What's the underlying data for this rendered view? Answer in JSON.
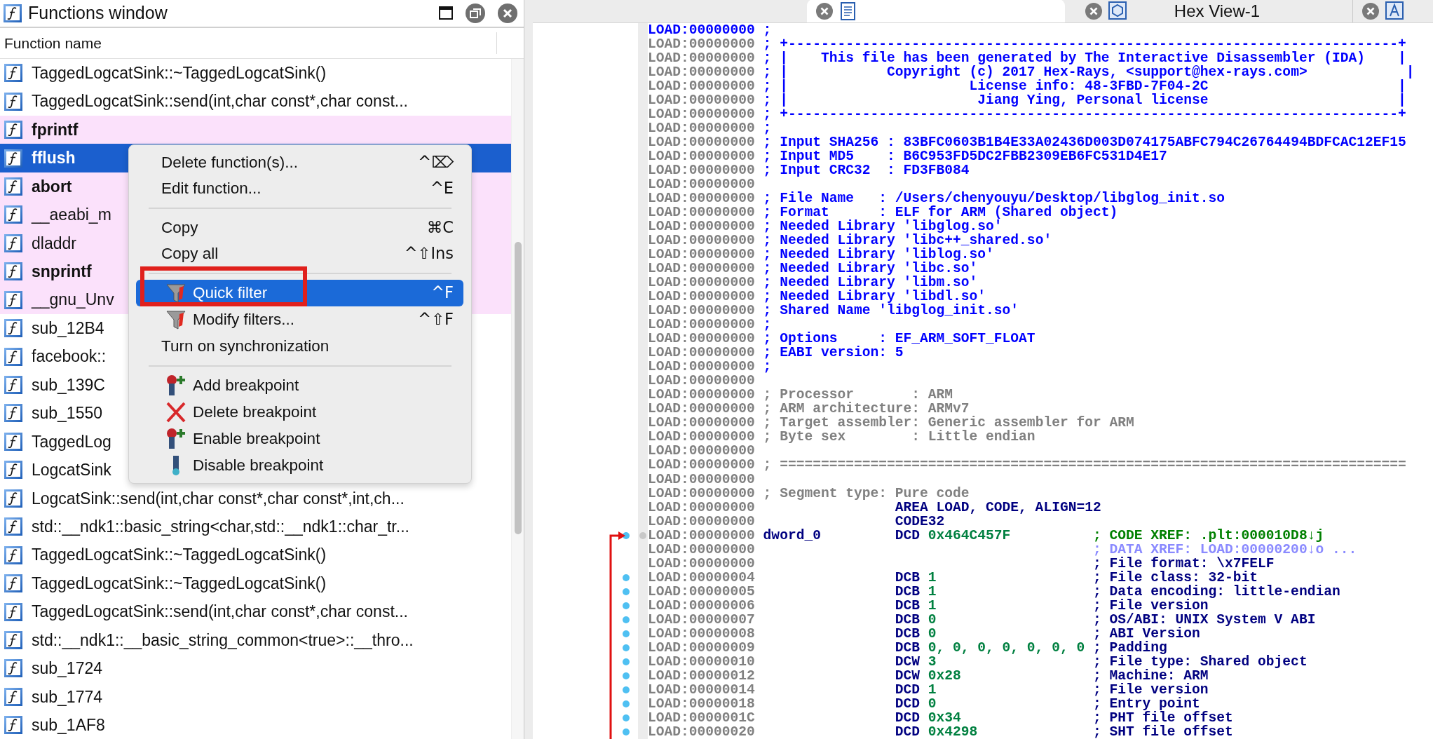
{
  "functions_window": {
    "title": "Functions window",
    "column": "Function name",
    "rows": [
      {
        "name": "TaggedLogcatSink::~TaggedLogcatSink()",
        "library": false,
        "bold": false,
        "selected": false
      },
      {
        "name": "TaggedLogcatSink::send(int,char const*,char const...",
        "library": false,
        "bold": false,
        "selected": false
      },
      {
        "name": "fprintf",
        "library": true,
        "bold": true,
        "selected": false
      },
      {
        "name": "fflush",
        "library": true,
        "bold": true,
        "selected": true
      },
      {
        "name": "abort",
        "library": true,
        "bold": true,
        "selected": false
      },
      {
        "name": "__aeabi_m",
        "library": true,
        "bold": false,
        "selected": false
      },
      {
        "name": "dladdr",
        "library": true,
        "bold": false,
        "selected": false
      },
      {
        "name": "snprintf",
        "library": true,
        "bold": true,
        "selected": false
      },
      {
        "name": "__gnu_Unv",
        "library": true,
        "bold": false,
        "selected": false
      },
      {
        "name": "sub_12B4",
        "library": false,
        "bold": false,
        "selected": false
      },
      {
        "name": "facebook::",
        "library": false,
        "bold": false,
        "selected": false
      },
      {
        "name": "sub_139C",
        "library": false,
        "bold": false,
        "selected": false
      },
      {
        "name": "sub_1550",
        "library": false,
        "bold": false,
        "selected": false
      },
      {
        "name": "TaggedLog",
        "library": false,
        "bold": false,
        "selected": false
      },
      {
        "name": "LogcatSink",
        "library": false,
        "bold": false,
        "selected": false
      },
      {
        "name": "LogcatSink::send(int,char const*,char const*,int,ch...",
        "library": false,
        "bold": false,
        "selected": false
      },
      {
        "name": "std::__ndk1::basic_string<char,std::__ndk1::char_tr...",
        "library": false,
        "bold": false,
        "selected": false
      },
      {
        "name": "TaggedLogcatSink::~TaggedLogcatSink()",
        "library": false,
        "bold": false,
        "selected": false
      },
      {
        "name": "TaggedLogcatSink::~TaggedLogcatSink()",
        "library": false,
        "bold": false,
        "selected": false
      },
      {
        "name": "TaggedLogcatSink::send(int,char const*,char const...",
        "library": false,
        "bold": false,
        "selected": false
      },
      {
        "name": "std::__ndk1::__basic_string_common<true>::__thro...",
        "library": false,
        "bold": false,
        "selected": false
      },
      {
        "name": "sub_1724",
        "library": false,
        "bold": false,
        "selected": false
      },
      {
        "name": "sub_1774",
        "library": false,
        "bold": false,
        "selected": false
      },
      {
        "name": "sub_1AF8",
        "library": false,
        "bold": false,
        "selected": false
      }
    ]
  },
  "context_menu": [
    {
      "kind": "plain",
      "label": "Delete function(s)...",
      "shortcut": "^⌦",
      "selected": false,
      "annotated": false
    },
    {
      "kind": "plain",
      "label": "Edit function...",
      "shortcut": "^E",
      "selected": false,
      "annotated": false
    },
    {
      "kind": "separator"
    },
    {
      "kind": "plain",
      "label": "Copy",
      "shortcut": "⌘C",
      "selected": false,
      "annotated": false
    },
    {
      "kind": "plain",
      "label": "Copy all",
      "shortcut": "^⇧Ins",
      "selected": false,
      "annotated": false
    },
    {
      "kind": "separator"
    },
    {
      "kind": "filter",
      "label": "Quick filter",
      "shortcut": "^F",
      "selected": true,
      "annotated": true
    },
    {
      "kind": "filter",
      "label": "Modify filters...",
      "shortcut": "^⇧F",
      "selected": false,
      "annotated": false
    },
    {
      "kind": "plain",
      "label": "Turn on synchronization",
      "selected": false,
      "annotated": false
    },
    {
      "kind": "separator"
    },
    {
      "kind": "add_breakpoint",
      "label": "Add breakpoint",
      "selected": false,
      "annotated": false
    },
    {
      "kind": "delete_breakpoint",
      "label": "Delete breakpoint",
      "selected": false,
      "annotated": false
    },
    {
      "kind": "add_breakpoint",
      "label": "Enable breakpoint",
      "selected": false,
      "annotated": false
    },
    {
      "kind": "disable_breakpoint",
      "label": "Disable breakpoint",
      "selected": false,
      "annotated": false
    }
  ],
  "tabs": [
    {
      "kind": "disassembly",
      "selected": true
    },
    {
      "kind": "hex",
      "label": "Hex View-1",
      "selected": false
    },
    {
      "kind": "structures",
      "selected": false
    }
  ],
  "listing": [
    {
      "addr": "LOAD:00000000",
      "current": true,
      "kind": "note",
      "text": ";",
      "dot": false,
      "jump_target": false
    },
    {
      "addr": "LOAD:00000000",
      "current": false,
      "kind": "note",
      "text": "; +--------------------------------------------------------------------------+",
      "dot": false,
      "jump_target": false
    },
    {
      "addr": "LOAD:00000000",
      "current": false,
      "kind": "note",
      "text": "; |    This file has been generated by The Interactive Disassembler (IDA)    |",
      "dot": false,
      "jump_target": false
    },
    {
      "addr": "LOAD:00000000",
      "current": false,
      "kind": "note",
      "text": "; |            Copyright (c) 2017 Hex-Rays, <support@hex-rays.com>            |",
      "dot": false,
      "jump_target": false
    },
    {
      "addr": "LOAD:00000000",
      "current": false,
      "kind": "note",
      "text": "; |                      License info: 48-3FBD-7F04-2C                       |",
      "dot": false,
      "jump_target": false
    },
    {
      "addr": "LOAD:00000000",
      "current": false,
      "kind": "note",
      "text": "; |                       Jiang Ying, Personal license                       |",
      "dot": false,
      "jump_target": false
    },
    {
      "addr": "LOAD:00000000",
      "current": false,
      "kind": "note",
      "text": "; +--------------------------------------------------------------------------+",
      "dot": false,
      "jump_target": false
    },
    {
      "addr": "LOAD:00000000",
      "current": false,
      "kind": "note",
      "text": ";",
      "dot": false,
      "jump_target": false
    },
    {
      "addr": "LOAD:00000000",
      "current": false,
      "kind": "note",
      "text": "; Input SHA256 : 83BFC0603B1B4E33A02436D003D074175ABFC794C26764494BDFCAC12EF15",
      "dot": false,
      "jump_target": false
    },
    {
      "addr": "LOAD:00000000",
      "current": false,
      "kind": "note",
      "text": "; Input MD5    : B6C953FD5DC2FBB2309EB6FC531D4E17",
      "dot": false,
      "jump_target": false
    },
    {
      "addr": "LOAD:00000000",
      "current": false,
      "kind": "note",
      "text": "; Input CRC32  : FD3FB084",
      "dot": false,
      "jump_target": false
    },
    {
      "addr": "LOAD:00000000",
      "current": false,
      "kind": "blank",
      "dot": false,
      "jump_target": false
    },
    {
      "addr": "LOAD:00000000",
      "current": false,
      "kind": "note",
      "text": "; File Name   : /Users/chenyouyu/Desktop/libglog_init.so",
      "dot": false,
      "jump_target": false
    },
    {
      "addr": "LOAD:00000000",
      "current": false,
      "kind": "note",
      "text": "; Format      : ELF for ARM (Shared object)",
      "dot": false,
      "jump_target": false
    },
    {
      "addr": "LOAD:00000000",
      "current": false,
      "kind": "note",
      "text": "; Needed Library 'libglog.so'",
      "dot": false,
      "jump_target": false
    },
    {
      "addr": "LOAD:00000000",
      "current": false,
      "kind": "note",
      "text": "; Needed Library 'libc++_shared.so'",
      "dot": false,
      "jump_target": false
    },
    {
      "addr": "LOAD:00000000",
      "current": false,
      "kind": "note",
      "text": "; Needed Library 'liblog.so'",
      "dot": false,
      "jump_target": false
    },
    {
      "addr": "LOAD:00000000",
      "current": false,
      "kind": "note",
      "text": "; Needed Library 'libc.so'",
      "dot": false,
      "jump_target": false
    },
    {
      "addr": "LOAD:00000000",
      "current": false,
      "kind": "note",
      "text": "; Needed Library 'libm.so'",
      "dot": false,
      "jump_target": false
    },
    {
      "addr": "LOAD:00000000",
      "current": false,
      "kind": "note",
      "text": "; Needed Library 'libdl.so'",
      "dot": false,
      "jump_target": false
    },
    {
      "addr": "LOAD:00000000",
      "current": false,
      "kind": "note",
      "text": "; Shared Name 'libglog_init.so'",
      "dot": false,
      "jump_target": false
    },
    {
      "addr": "LOAD:00000000",
      "current": false,
      "kind": "note",
      "text": ";",
      "dot": false,
      "jump_target": false
    },
    {
      "addr": "LOAD:00000000",
      "current": false,
      "kind": "note",
      "text": "; Options     : EF_ARM_SOFT_FLOAT",
      "dot": false,
      "jump_target": false
    },
    {
      "addr": "LOAD:00000000",
      "current": false,
      "kind": "note",
      "text": "; EABI version: 5",
      "dot": false,
      "jump_target": false
    },
    {
      "addr": "LOAD:00000000",
      "current": false,
      "kind": "note",
      "text": ";",
      "dot": false,
      "jump_target": false
    },
    {
      "addr": "LOAD:00000000",
      "current": false,
      "kind": "blank",
      "dot": false,
      "jump_target": false
    },
    {
      "addr": "LOAD:00000000",
      "current": false,
      "kind": "auto_note",
      "text": "; Processor       : ARM",
      "dot": false,
      "jump_target": false
    },
    {
      "addr": "LOAD:00000000",
      "current": false,
      "kind": "auto_note",
      "text": "; ARM architecture: ARMv7",
      "dot": false,
      "jump_target": false
    },
    {
      "addr": "LOAD:00000000",
      "current": false,
      "kind": "auto_note",
      "text": "; Target assembler: Generic assembler for ARM",
      "dot": false,
      "jump_target": false
    },
    {
      "addr": "LOAD:00000000",
      "current": false,
      "kind": "auto_note",
      "text": "; Byte sex        : Little endian",
      "dot": false,
      "jump_target": false
    },
    {
      "addr": "LOAD:00000000",
      "current": false,
      "kind": "blank",
      "dot": false,
      "jump_target": false
    },
    {
      "addr": "LOAD:00000000",
      "current": false,
      "kind": "auto_note",
      "text": "; ============================================================================",
      "dot": false,
      "jump_target": false
    },
    {
      "addr": "LOAD:00000000",
      "current": false,
      "kind": "blank",
      "dot": false,
      "jump_target": false
    },
    {
      "addr": "LOAD:00000000",
      "current": false,
      "kind": "auto_note",
      "text": "; Segment type: Pure code",
      "dot": false,
      "jump_target": false
    },
    {
      "addr": "LOAD:00000000",
      "current": false,
      "kind": "code",
      "instr": "AREA LOAD, CODE, ALIGN=12",
      "dot": false,
      "jump_target": false
    },
    {
      "addr": "LOAD:00000000",
      "current": false,
      "kind": "code",
      "instr": "CODE32",
      "dot": false,
      "jump_target": false
    },
    {
      "addr": "LOAD:00000000",
      "current": false,
      "kind": "code",
      "label": "dword_0",
      "instr": "DCD",
      "operand": "0x464C457F",
      "comment": {
        "text": "; CODE XREF: .plt:000010D8↓j",
        "color": "#008000"
      },
      "dot": true,
      "jump_target": true
    },
    {
      "addr": "LOAD:00000000",
      "current": false,
      "kind": "code",
      "comment": {
        "text": "; DATA XREF: LOAD:00000200↓o ...",
        "color": "#8a8aff"
      },
      "dot": false,
      "jump_target": false
    },
    {
      "addr": "LOAD:00000000",
      "current": false,
      "kind": "code",
      "comment": {
        "text": "; File format: \\x7FELF",
        "color": "#000080"
      },
      "dot": false,
      "jump_target": false
    },
    {
      "addr": "LOAD:00000004",
      "current": false,
      "kind": "code",
      "instr": "DCB",
      "operand": "1",
      "comment": {
        "text": "; File class: 32-bit",
        "color": "#000080"
      },
      "dot": true,
      "jump_target": false
    },
    {
      "addr": "LOAD:00000005",
      "current": false,
      "kind": "code",
      "instr": "DCB",
      "operand": "1",
      "comment": {
        "text": "; Data encoding: little-endian",
        "color": "#000080"
      },
      "dot": true,
      "jump_target": false
    },
    {
      "addr": "LOAD:00000006",
      "current": false,
      "kind": "code",
      "instr": "DCB",
      "operand": "1",
      "comment": {
        "text": "; File version",
        "color": "#000080"
      },
      "dot": true,
      "jump_target": false
    },
    {
      "addr": "LOAD:00000007",
      "current": false,
      "kind": "code",
      "instr": "DCB",
      "operand": "0",
      "comment": {
        "text": "; OS/ABI: UNIX System V ABI",
        "color": "#000080"
      },
      "dot": true,
      "jump_target": false
    },
    {
      "addr": "LOAD:00000008",
      "current": false,
      "kind": "code",
      "instr": "DCB",
      "operand": "0",
      "comment": {
        "text": "; ABI Version",
        "color": "#000080"
      },
      "dot": true,
      "jump_target": false
    },
    {
      "addr": "LOAD:00000009",
      "current": false,
      "kind": "code",
      "instr": "DCB",
      "operand": "0, 0, 0, 0, 0, 0, 0",
      "comment": {
        "text": "; Padding",
        "color": "#000080"
      },
      "dot": true,
      "jump_target": false
    },
    {
      "addr": "LOAD:00000010",
      "current": false,
      "kind": "code",
      "instr": "DCW",
      "operand": "3",
      "comment": {
        "text": "; File type: Shared object",
        "color": "#000080"
      },
      "dot": true,
      "jump_target": false
    },
    {
      "addr": "LOAD:00000012",
      "current": false,
      "kind": "code",
      "instr": "DCW",
      "operand": "0x28",
      "comment": {
        "text": "; Machine: ARM",
        "color": "#000080"
      },
      "dot": true,
      "jump_target": false
    },
    {
      "addr": "LOAD:00000014",
      "current": false,
      "kind": "code",
      "instr": "DCD",
      "operand": "1",
      "comment": {
        "text": "; File version",
        "color": "#000080"
      },
      "dot": true,
      "jump_target": false
    },
    {
      "addr": "LOAD:00000018",
      "current": false,
      "kind": "code",
      "instr": "DCD",
      "operand": "0",
      "comment": {
        "text": "; Entry point",
        "color": "#000080"
      },
      "dot": true,
      "jump_target": false
    },
    {
      "addr": "LOAD:0000001C",
      "current": false,
      "kind": "code",
      "instr": "DCD",
      "operand": "0x34",
      "comment": {
        "text": "; PHT file offset",
        "color": "#000080"
      },
      "dot": true,
      "jump_target": false
    },
    {
      "addr": "LOAD:00000020",
      "current": false,
      "kind": "code",
      "instr": "DCD",
      "operand": "0x4298",
      "comment": {
        "text": "; SHT file offset",
        "color": "#000080"
      },
      "dot": true,
      "jump_target": false
    }
  ]
}
